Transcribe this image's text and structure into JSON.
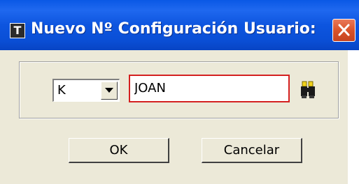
{
  "window": {
    "title": "Nuevo Nº Configuración Usuario:",
    "app_icon_letter": "T",
    "titlebar_color": "#0a4fd6",
    "close_button_color": "#d9532a"
  },
  "form": {
    "prefix_select": {
      "selected": "K"
    },
    "name_input": {
      "value": "JOAN",
      "border_color": "#d42020"
    },
    "search_button_icon": "binoculars-icon"
  },
  "buttons": {
    "ok_label": "OK",
    "cancel_label": "Cancelar"
  }
}
